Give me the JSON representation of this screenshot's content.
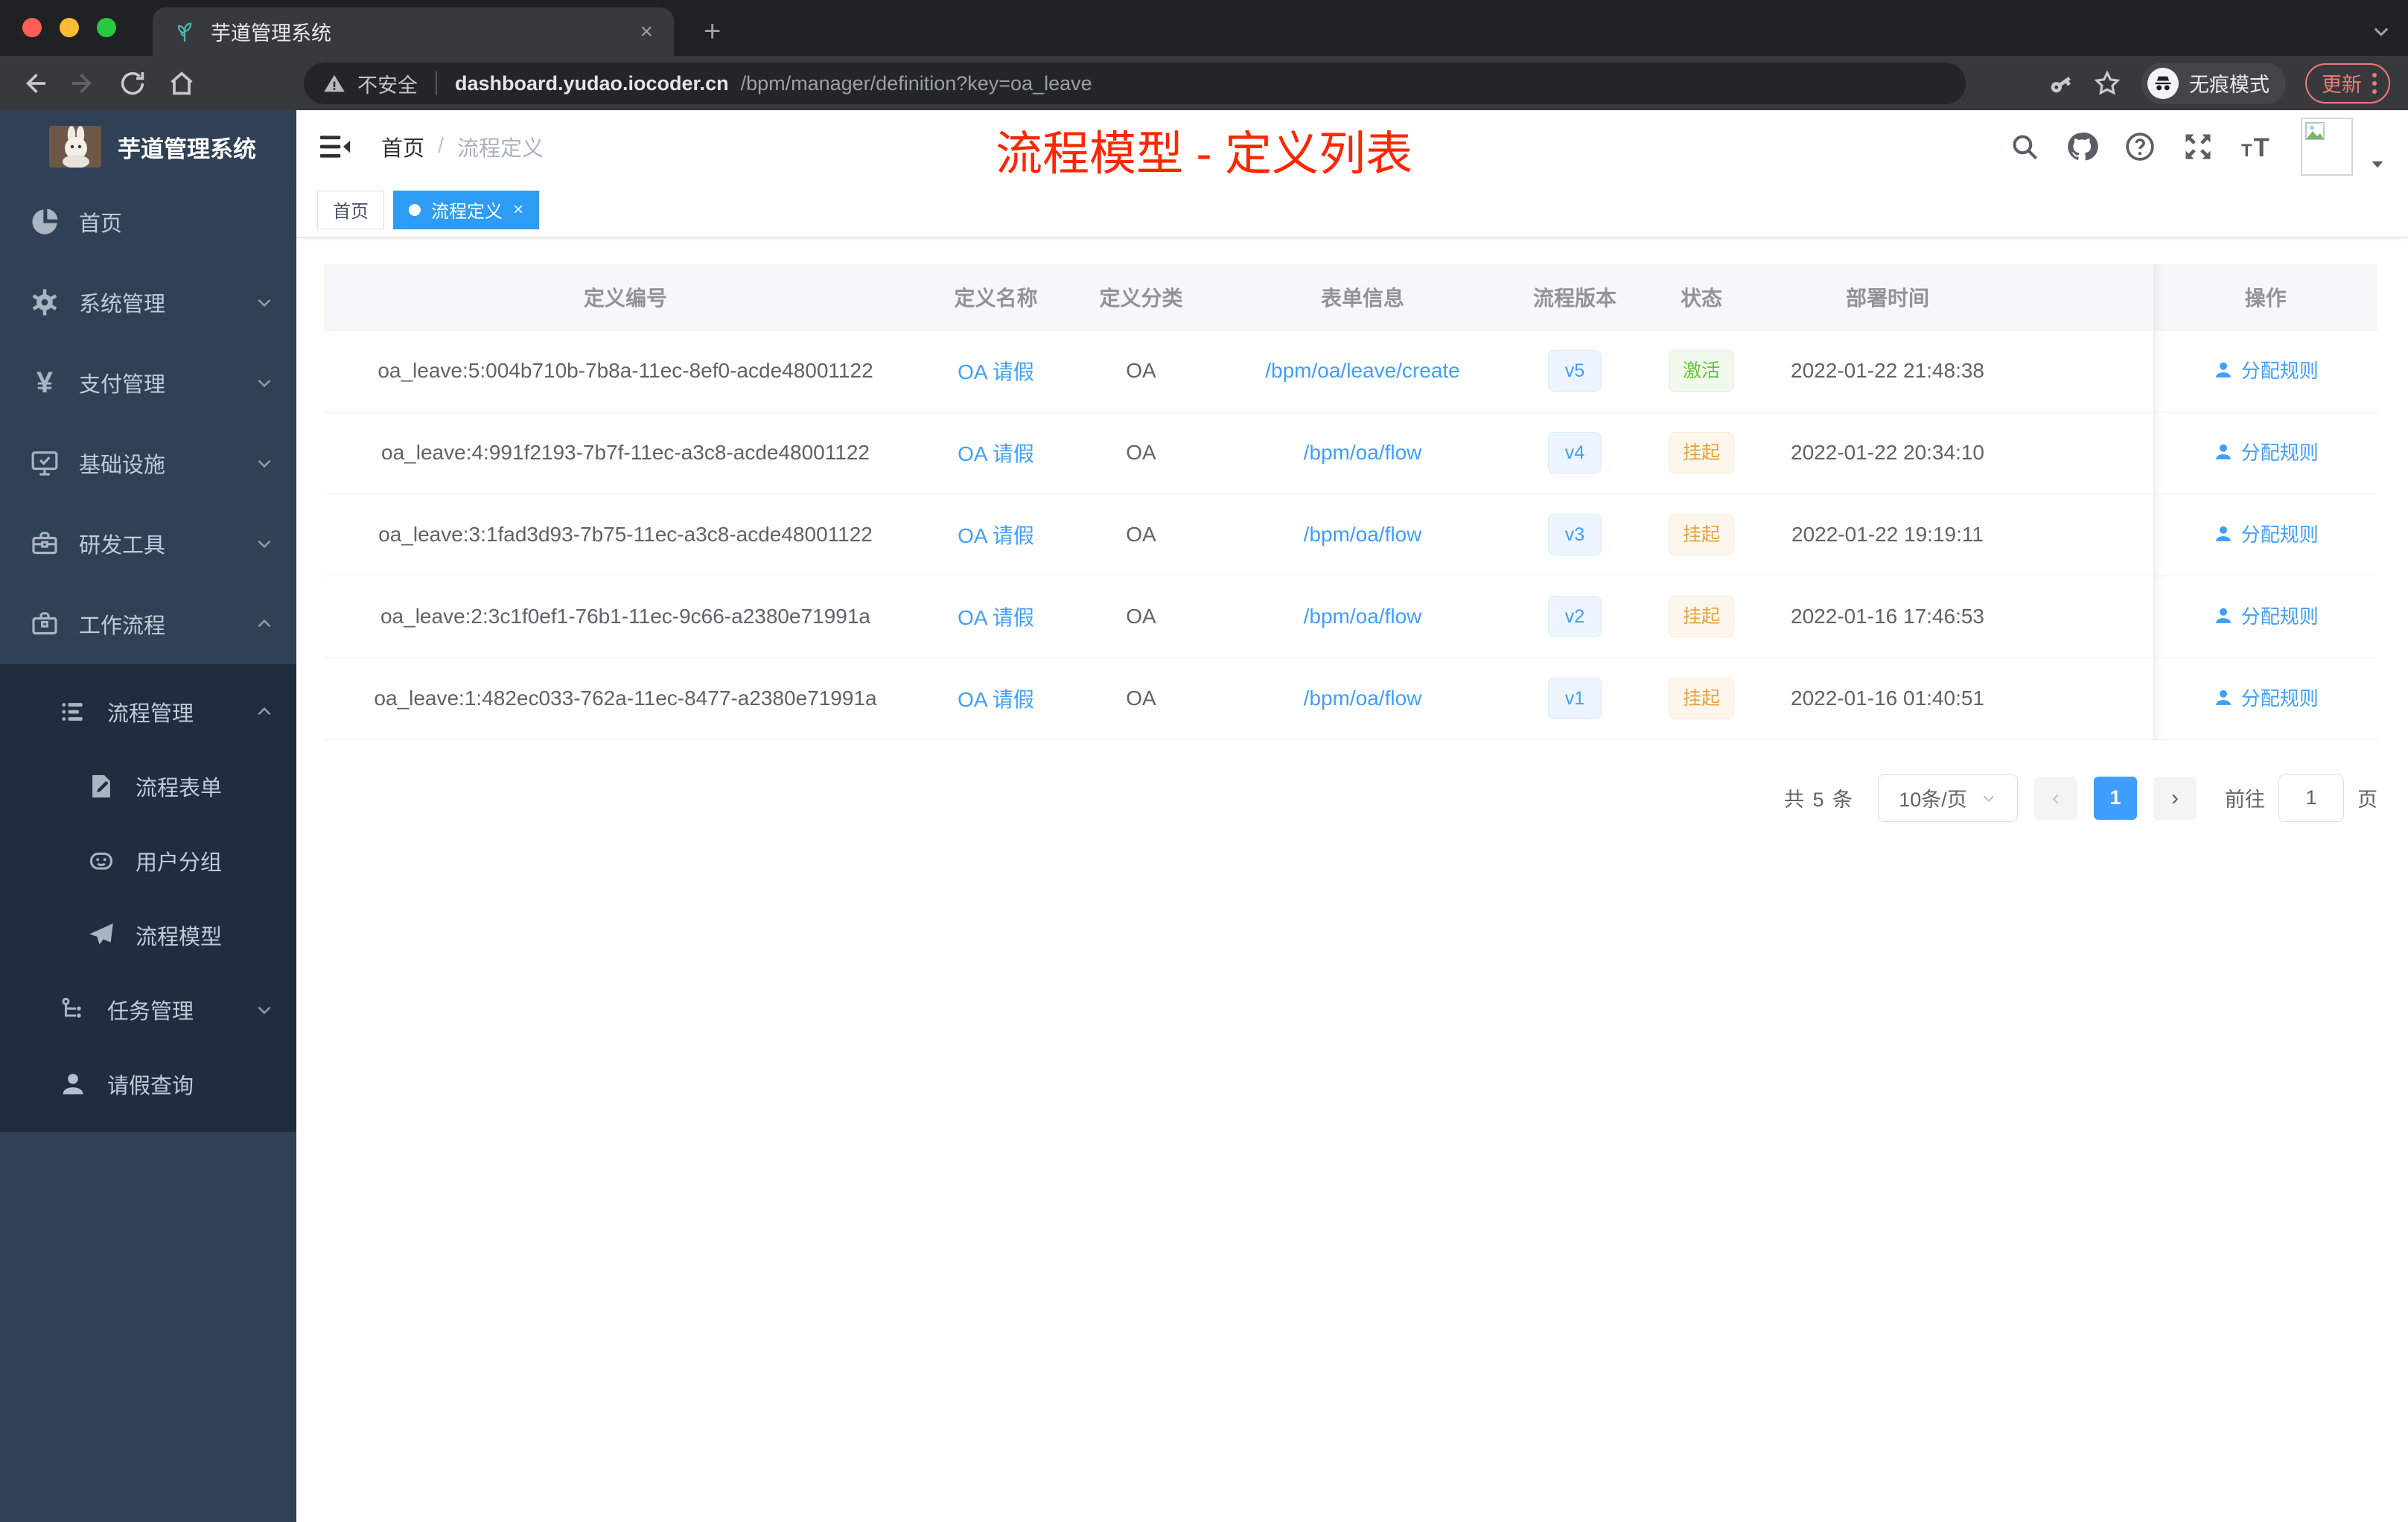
{
  "browser": {
    "tab": {
      "title": "芋道管理系统",
      "close_glyph": "×",
      "new_tab_glyph": "+"
    },
    "toolbar": {
      "security_label": "不安全",
      "url_domain": "dashboard.yudao.iocoder.cn",
      "url_path": "/bpm/manager/definition?key=oa_leave",
      "incognito_label": "无痕模式",
      "update_label": "更新"
    }
  },
  "sidebar": {
    "logo_title": "芋道管理系统",
    "items": [
      {
        "label": "首页",
        "icon": "dashboard-icon"
      },
      {
        "label": "系统管理",
        "icon": "gear-icon",
        "state": "collapsed"
      },
      {
        "label": "支付管理",
        "icon": "yen-icon",
        "state": "collapsed"
      },
      {
        "label": "基础设施",
        "icon": "monitor-icon",
        "state": "collapsed"
      },
      {
        "label": "研发工具",
        "icon": "toolbox-icon",
        "state": "collapsed"
      },
      {
        "label": "工作流程",
        "icon": "briefcase-icon",
        "state": "expanded"
      }
    ],
    "submenu": [
      {
        "label": "流程管理",
        "icon": "list-icon",
        "state": "expanded"
      },
      {
        "label": "流程表单",
        "icon": "form-icon"
      },
      {
        "label": "用户分组",
        "icon": "robot-icon"
      },
      {
        "label": "流程模型",
        "icon": "paper-plane-icon"
      },
      {
        "label": "任务管理",
        "icon": "tree-icon",
        "state": "collapsed"
      },
      {
        "label": "请假查询",
        "icon": "user-icon"
      }
    ]
  },
  "header": {
    "breadcrumb_home": "首页",
    "breadcrumb_sep": "/",
    "breadcrumb_current": "流程定义"
  },
  "annotation": {
    "title": "流程模型 - 定义列表"
  },
  "tags": {
    "home": "首页",
    "active": "流程定义",
    "close_glyph": "×"
  },
  "table": {
    "columns": [
      "定义编号",
      "定义名称",
      "定义分类",
      "表单信息",
      "流程版本",
      "状态",
      "部署时间",
      "操作"
    ],
    "rows": [
      {
        "id": "oa_leave:5:004b710b-7b8a-11ec-8ef0-acde48001122",
        "name": "OA 请假",
        "category": "OA",
        "form": "/bpm/oa/leave/create",
        "version": "v5",
        "status": "激活",
        "status_type": "active",
        "time": "2022-01-22 21:48:38",
        "action": "分配规则"
      },
      {
        "id": "oa_leave:4:991f2193-7b7f-11ec-a3c8-acde48001122",
        "name": "OA 请假",
        "category": "OA",
        "form": "/bpm/oa/flow",
        "version": "v4",
        "status": "挂起",
        "status_type": "suspended",
        "time": "2022-01-22 20:34:10",
        "action": "分配规则"
      },
      {
        "id": "oa_leave:3:1fad3d93-7b75-11ec-a3c8-acde48001122",
        "name": "OA 请假",
        "category": "OA",
        "form": "/bpm/oa/flow",
        "version": "v3",
        "status": "挂起",
        "status_type": "suspended",
        "time": "2022-01-22 19:19:11",
        "action": "分配规则"
      },
      {
        "id": "oa_leave:2:3c1f0ef1-76b1-11ec-9c66-a2380e71991a",
        "name": "OA 请假",
        "category": "OA",
        "form": "/bpm/oa/flow",
        "version": "v2",
        "status": "挂起",
        "status_type": "suspended",
        "time": "2022-01-16 17:46:53",
        "action": "分配规则"
      },
      {
        "id": "oa_leave:1:482ec033-762a-11ec-8477-a2380e71991a",
        "name": "OA 请假",
        "category": "OA",
        "form": "/bpm/oa/flow",
        "version": "v1",
        "status": "挂起",
        "status_type": "suspended",
        "time": "2022-01-16 01:40:51",
        "action": "分配规则"
      }
    ]
  },
  "pagination": {
    "total": "共 5 条",
    "page_size": "10条/页",
    "prev_glyph": "‹",
    "current_page": "1",
    "next_glyph": "›",
    "goto_label": "前往",
    "goto_value": "1",
    "page_unit": "页"
  },
  "colors": {
    "accent": "#409eff",
    "annotation_red": "#ff2600",
    "sidebar_bg": "#304156",
    "submenu_bg": "#1f2d3d",
    "active_tag_bg": "#2d9cf4",
    "status_active_text": "#67c23a",
    "status_suspended_text": "#e6a23c",
    "version_tag_text": "#409eff"
  }
}
